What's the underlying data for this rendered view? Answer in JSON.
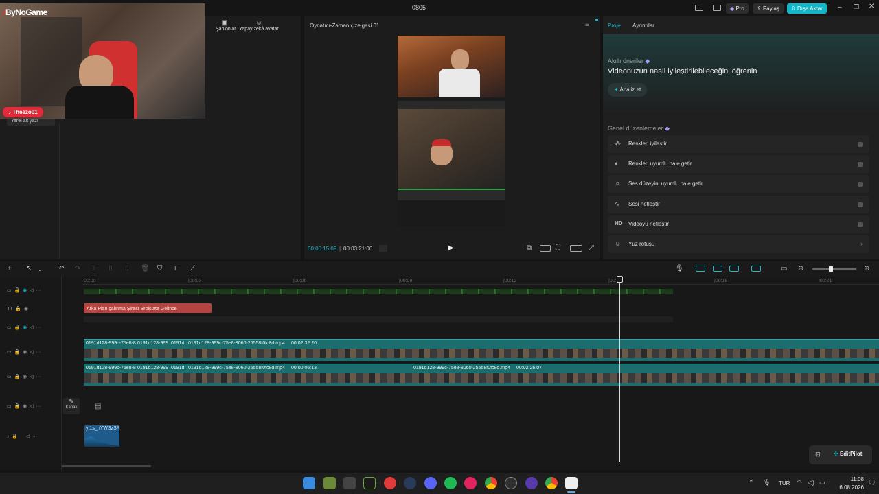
{
  "titlebar": {
    "title": "0805",
    "pro": "Pro",
    "share": "Paylaş",
    "export": "Dışa Aktar",
    "colors": {
      "export": "#11b6c8"
    }
  },
  "webcam": {
    "brand": "ByNoGame",
    "tiktok_user": "Theezo01",
    "caption": "Yerel alt yazı"
  },
  "left_tabs": {
    "templates": "Şablonlar",
    "ai_avatar": "Yapay zekâ avatar"
  },
  "player": {
    "title": "Oynatıcı-Zaman çizelgesi 01",
    "current_time": "00:00:15:09",
    "total_time": "00:03:21:00",
    "colors": {
      "current_time": "#1fb8c4"
    }
  },
  "right_panel": {
    "tab_project": "Proje",
    "tab_details": "Ayrıntılar",
    "smart_label": "Akıllı öneriler",
    "smart_heading": "Videonuzun nasıl iyileştirilebileceğini öğrenin",
    "analyze_button": "Analiz et",
    "general_label": "Genel düzenlemeler",
    "items": [
      {
        "label": "Renkleri iyileştir",
        "icon": "wand-icon"
      },
      {
        "label": "Renkleri uyumlu hale getir",
        "icon": "palette-icon"
      },
      {
        "label": "Ses düzeyini uyumlu hale getir",
        "icon": "volume-level-icon"
      },
      {
        "label": "Sesi netleştir",
        "icon": "audio-wave-icon"
      },
      {
        "label": "Videoyu netleştir",
        "icon": "hd-icon"
      },
      {
        "label": "Yüz rötuşu",
        "icon": "face-icon"
      }
    ]
  },
  "timeline": {
    "ruler": [
      "00:00",
      "|00:03",
      "|00:06",
      "|00:09",
      "|00:12",
      "|00:15",
      "|00:18",
      "|00:21"
    ],
    "text_clip": "Arka Plan çalınma Şirası Broislate Gelince",
    "v1_clips": [
      "0191d128-999c-75e8-8",
      "0191d128-999",
      "0191d",
      "0191d128-999c-75e8-8060-25558f0fc8d.mp4",
      "00:02:32:20"
    ],
    "v2_clips": [
      "0191d128-999c-75e8-8",
      "0191d128-999",
      "0191d",
      "0191d128-999c-75e8-8060-25558f0fc8d.mp4",
      "00:00:06:13",
      "0191d128-999c-75e8-8060-25558f0fc8d.mp4",
      "00:02:26:07"
    ],
    "cover_label": "Kapak",
    "audio_clip": "yt1s_nYWSzSR",
    "editpilot": "EditPilot"
  },
  "taskbar": {
    "language": "TUR",
    "time": "11:08",
    "date": "6.08.2026",
    "apps": [
      "windows-start-icon",
      "minecraft-icon",
      "game-launcher-icon",
      "nvidia-icon",
      "app-red-icon",
      "steam-icon",
      "discord-icon",
      "spotify-icon",
      "media-player-icon",
      "chrome-icon",
      "obs-icon",
      "browser-icon",
      "chrome-canary-icon",
      "capcut-icon"
    ]
  }
}
